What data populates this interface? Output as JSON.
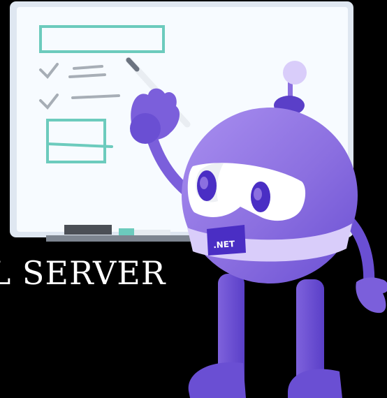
{
  "caption": {
    "text": "QL SERVER"
  },
  "badge": {
    "text": ".NET"
  },
  "colors": {
    "background": "#000000",
    "whiteboard": "#f7fbff",
    "whiteboard_frame": "#dfe7f1",
    "sketch_teal": "#6ccbbd",
    "sketch_gray": "#a7aeb6",
    "robot_body": "#8b6fe0",
    "robot_body_light": "#a98ff0",
    "robot_body_dark": "#5a3fc8",
    "robot_band": "#d9cdfa",
    "badge": "#4a2ec4",
    "visor": "#ffffff"
  },
  "icons": {
    "pen": "marker-pen-icon",
    "checkmark": "checkmark-icon"
  }
}
